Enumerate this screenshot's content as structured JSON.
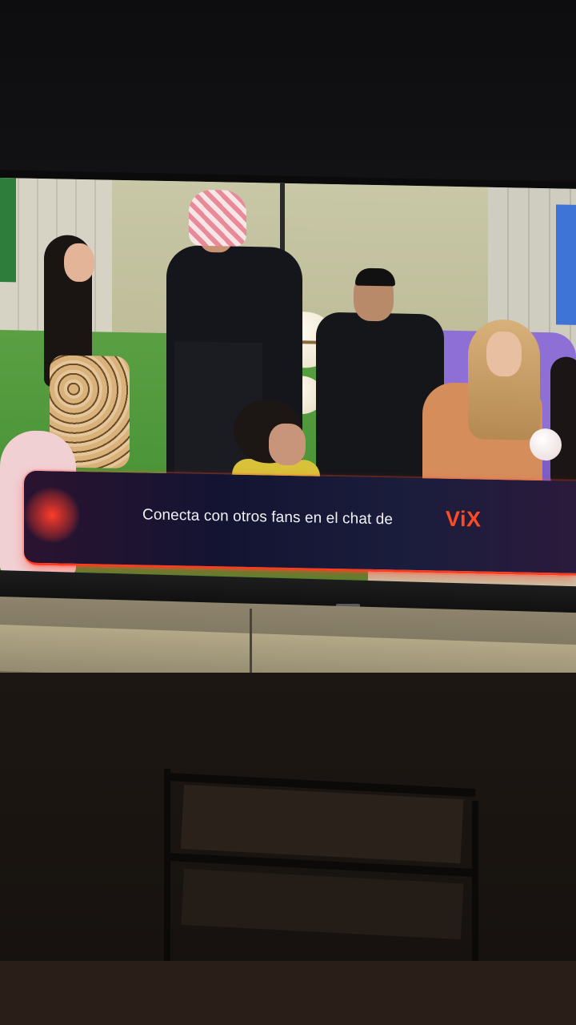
{
  "banner": {
    "text": "Conecta con otros fans en el chat de",
    "brand": "ViX"
  },
  "colors": {
    "brand_accent": "#ff4a26",
    "banner_bg": "#131432",
    "sofa": "#8d6fd6"
  }
}
